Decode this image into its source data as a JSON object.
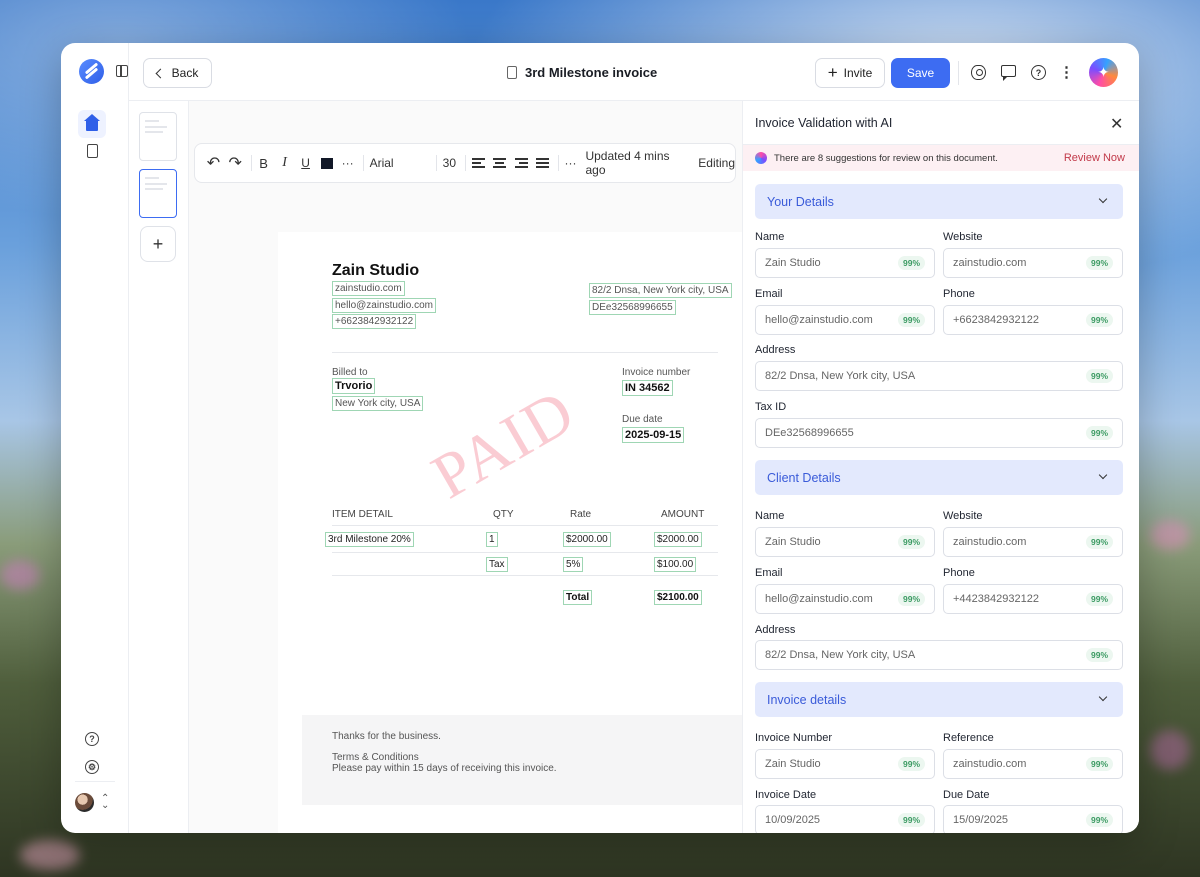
{
  "topbar": {
    "back_label": "Back",
    "doc_title": "3rd Milestone invoice",
    "invite_label": "Invite",
    "save_label": "Save"
  },
  "toolbar": {
    "font": "Arial",
    "font_size": "30",
    "status": "Updated 4 mins ago",
    "mode": "Editing",
    "bold": "B",
    "italic": "I",
    "underline": "U",
    "more": "···"
  },
  "invoice": {
    "company": "Zain Studio",
    "website": "zainstudio.com",
    "email": "hello@zainstudio.com",
    "phone": "+6623842932122",
    "address": "82/2 Dnsa, New York city, USA",
    "tax_id": "DEe32568996655",
    "billed_to_label": "Billed to",
    "client": "Trvorio",
    "client_city": "New York city, USA",
    "invoice_number_label": "Invoice number",
    "invoice_number": "IN 34562",
    "due_date_label": "Due date",
    "due_date": "2025-09-15",
    "watermark": "PAID",
    "table": {
      "headers": [
        "ITEM DETAIL",
        "QTY",
        "Rate",
        "AMOUNT"
      ],
      "item": "3rd Milestone 20%",
      "qty": "1",
      "rate": "$2000.00",
      "amount": "$2000.00",
      "tax_label": "Tax",
      "tax_rate": "5%",
      "tax_amount": "$100.00",
      "total_label": "Total",
      "total": "$2100.00"
    },
    "thanks": "Thanks for the business.",
    "terms_title": "Terms & Conditions",
    "terms_text": "Please pay within 15 days of receiving this invoice."
  },
  "ai_panel": {
    "title": "Invoice Validation with AI",
    "banner": "There are 8 suggestions for review on this document.",
    "review_now": "Review Now",
    "confidence": "99%",
    "your_details": {
      "heading": "Your Details",
      "name_label": "Name",
      "name": "Zain Studio",
      "website_label": "Website",
      "website": "zainstudio.com",
      "email_label": "Email",
      "email": "hello@zainstudio.com",
      "phone_label": "Phone",
      "phone": "+6623842932122",
      "address_label": "Address",
      "address": "82/2 Dnsa, New York city, USA",
      "taxid_label": "Tax ID",
      "taxid": "DEe32568996655"
    },
    "client_details": {
      "heading": "Client Details",
      "name_label": "Name",
      "name": "Zain Studio",
      "website_label": "Website",
      "website": "zainstudio.com",
      "email_label": "Email",
      "email": "hello@zainstudio.com",
      "phone_label": "Phone",
      "phone": "+4423842932122",
      "address_label": "Address",
      "address": "82/2 Dnsa, New York city, USA"
    },
    "invoice_details": {
      "heading": "Invoice details",
      "number_label": "Invoice Number",
      "number": "Zain Studio",
      "reference_label": "Reference",
      "reference": "zainstudio.com",
      "date_label": "Invoice Date",
      "date": "10/09/2025",
      "due_label": "Due Date",
      "due": "15/09/2025"
    }
  },
  "colors": {
    "accent": "#3d6cf2",
    "section_bg": "#e3e9fd",
    "confidence_green": "#3c9b63",
    "review_red": "#c23a4a"
  }
}
